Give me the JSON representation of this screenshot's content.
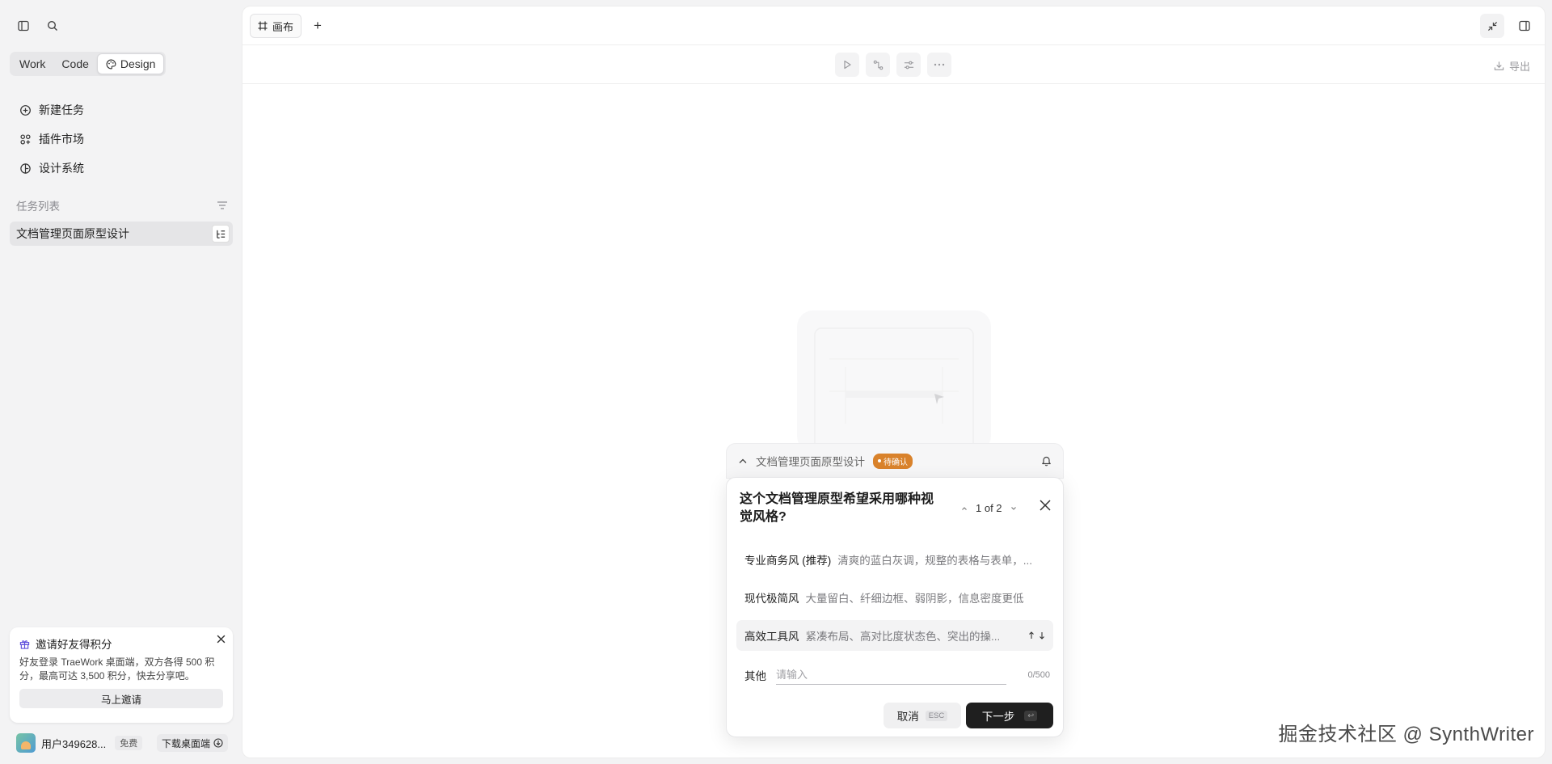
{
  "sidebar": {
    "modes": [
      {
        "label": "Work"
      },
      {
        "label": "Code"
      },
      {
        "label": "Design",
        "active": true
      }
    ],
    "nav": [
      {
        "label": "新建任务",
        "icon": "new-task-icon"
      },
      {
        "label": "插件市场",
        "icon": "plugin-market-icon"
      },
      {
        "label": "设计系统",
        "icon": "design-system-icon"
      }
    ],
    "task_section_title": "任务列表",
    "tasks": [
      {
        "label": "文档管理页面原型设计"
      }
    ],
    "invite": {
      "title": "邀请好友得积分",
      "body": "好友登录 TraeWork 桌面端，双方各得 500 积分，最高可达 3,500 积分，快去分享吧。",
      "button": "马上邀请"
    },
    "user": {
      "name": "用户349628...",
      "badge": "免费",
      "download": "下载桌面端"
    }
  },
  "main": {
    "tab_label": "画布",
    "export_label": "导出"
  },
  "dialog": {
    "header_title": "文档管理页面原型设计",
    "status": "待确认",
    "question": "这个文档管理原型希望采用哪种视觉风格?",
    "pager": "1 of 2",
    "options": [
      {
        "name": "专业商务风 (推荐)",
        "desc": "清爽的蓝白灰调，规整的表格与表单，..."
      },
      {
        "name": "现代极简风",
        "desc": "大量留白、纤细边框、弱阴影，信息密度更低"
      },
      {
        "name": "高效工具风",
        "desc": "紧凑布局、高对比度状态色、突出的操...",
        "highlighted": true
      }
    ],
    "other_label": "其他",
    "other_placeholder": "请输入",
    "char_count": "0/500",
    "cancel_label": "取消",
    "cancel_key": "ESC",
    "next_label": "下一步",
    "next_key": "↩"
  },
  "watermark": "掘金技术社区 @ SynthWriter",
  "colors": {
    "accent_dark": "#1f1f1f",
    "pending": "#d9822b",
    "sidebar_bg": "#f3f3f4"
  }
}
